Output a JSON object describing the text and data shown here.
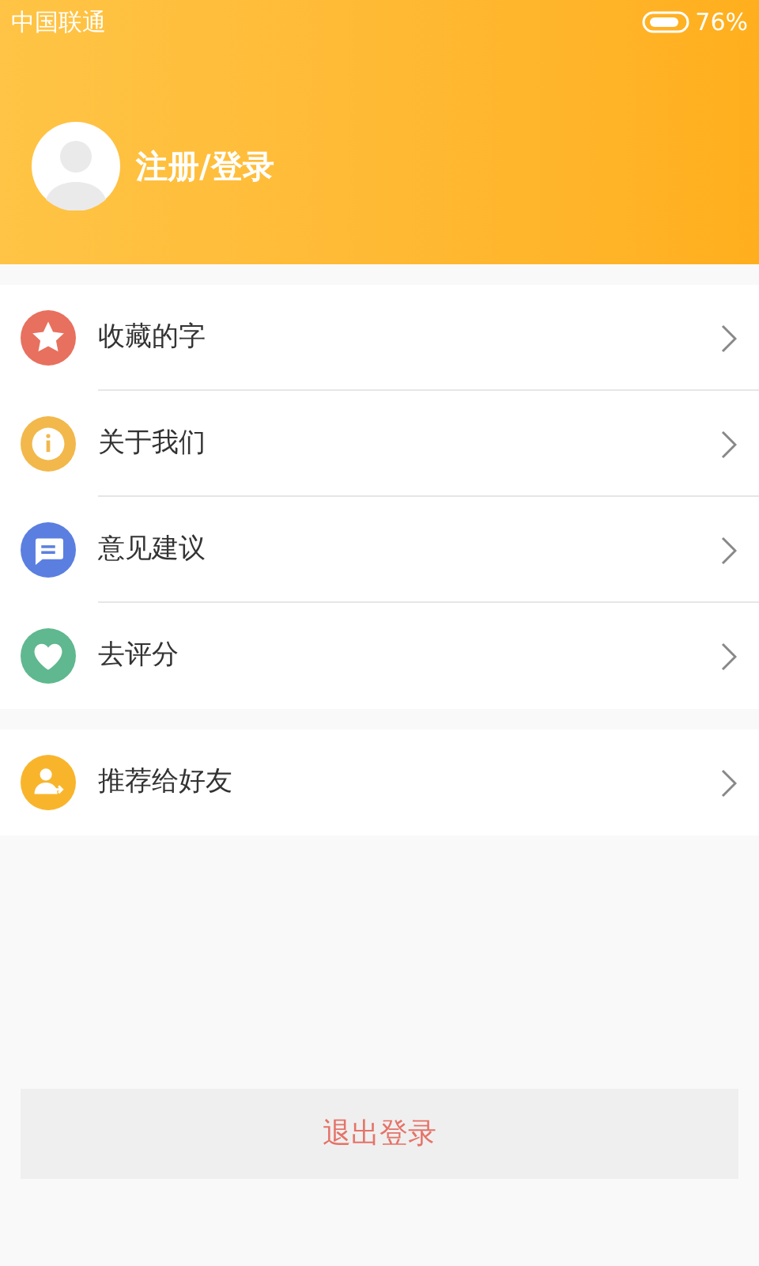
{
  "status_bar": {
    "carrier": "中国联通",
    "battery": "76%"
  },
  "profile": {
    "login_label": "注册/登录"
  },
  "menu_groups": [
    {
      "items": [
        {
          "label": "收藏的字",
          "kind": "star",
          "color": "#e8705e"
        },
        {
          "label": "关于我们",
          "kind": "info",
          "color": "#f2b84b"
        },
        {
          "label": "意见建议",
          "kind": "message",
          "color": "#5b7fe0"
        },
        {
          "label": "去评分",
          "kind": "heart",
          "color": "#5fb88f"
        }
      ]
    },
    {
      "items": [
        {
          "label": "推荐给好友",
          "kind": "share",
          "color": "#f8b52c"
        }
      ]
    }
  ],
  "logout_button": "退出登录"
}
